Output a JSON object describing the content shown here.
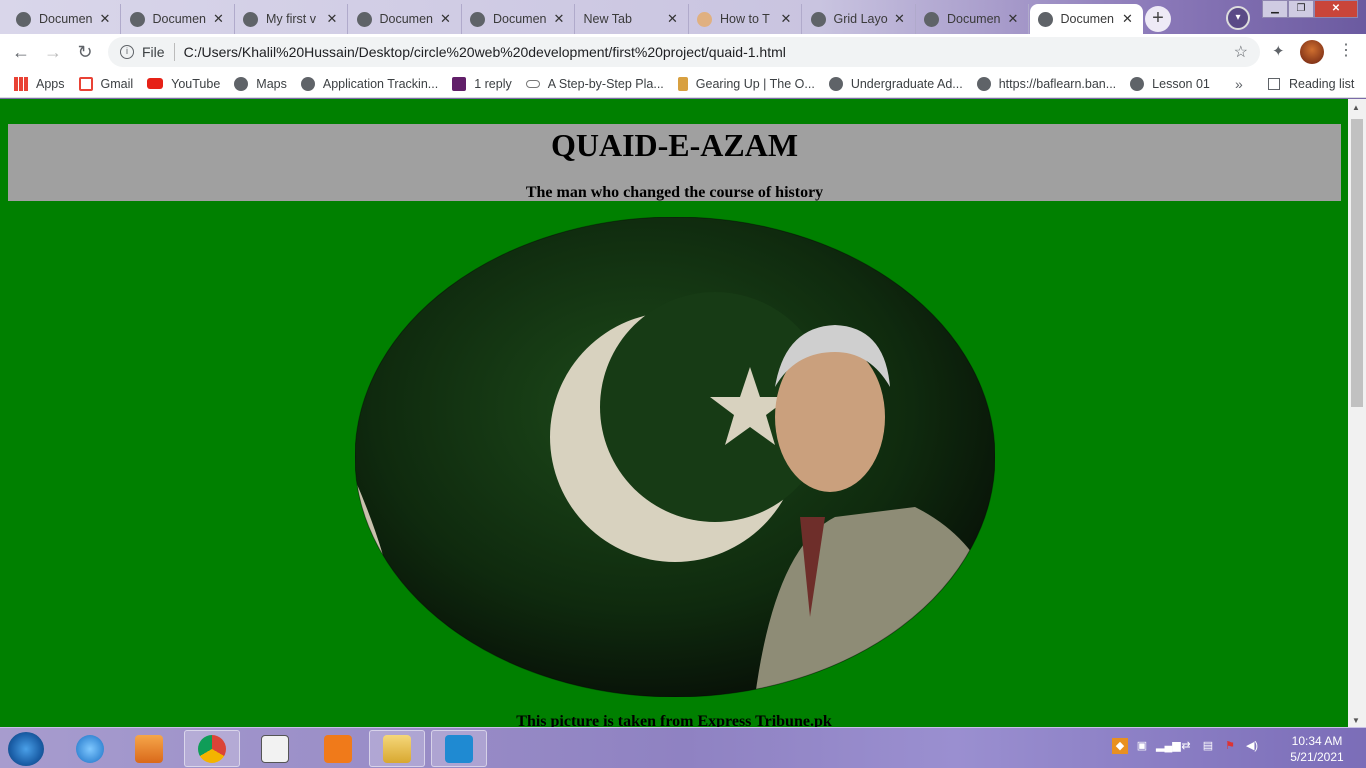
{
  "browser": {
    "tabs": [
      {
        "label": "Documen",
        "icon": "globe-icon"
      },
      {
        "label": "Documen",
        "icon": "globe-icon"
      },
      {
        "label": "My first v",
        "icon": "globe-icon"
      },
      {
        "label": "Documen",
        "icon": "globe-icon"
      },
      {
        "label": "Documen",
        "icon": "globe-icon"
      },
      {
        "label": "New Tab",
        "icon": "none"
      },
      {
        "label": "How to T",
        "icon": "face-icon"
      },
      {
        "label": "Grid Layo",
        "icon": "globe-icon"
      },
      {
        "label": "Documen",
        "icon": "globe-icon"
      },
      {
        "label": "Documen",
        "icon": "globe-icon"
      }
    ],
    "active_tab_index": 9,
    "address": {
      "scheme_label": "File",
      "url": "C:/Users/Khalil%20Hussain/Desktop/circle%20web%20development/first%20project/quaid-1.html"
    },
    "bookmarks": [
      {
        "label": "Apps",
        "icon": "apps-grid-icon"
      },
      {
        "label": "Gmail",
        "icon": "gmail-icon"
      },
      {
        "label": "YouTube",
        "icon": "youtube-icon"
      },
      {
        "label": "Maps",
        "icon": "globe-icon"
      },
      {
        "label": "Application Trackin...",
        "icon": "globe-icon"
      },
      {
        "label": "1 reply",
        "icon": "slack-icon"
      },
      {
        "label": "A Step-by-Step Pla...",
        "icon": "link-icon"
      },
      {
        "label": "Gearing Up | The O...",
        "icon": "mug-icon"
      },
      {
        "label": "Undergraduate Ad...",
        "icon": "globe-icon"
      },
      {
        "label": "https://baflearn.ban...",
        "icon": "globe-icon"
      },
      {
        "label": "Lesson 01",
        "icon": "globe-icon"
      }
    ],
    "more_bookmarks": "»",
    "reading_list": "Reading list"
  },
  "page": {
    "title": "QUAID-E-AZAM",
    "subtitle": "The man who changed the course of history",
    "image_alt": "Quaid-e-Azam portrait with Pakistan flag",
    "caption": "This picture is taken from Express Tribune.pk",
    "colors": {
      "background": "#008000",
      "header": "#a0a0a0"
    }
  },
  "taskbar": {
    "apps": [
      "internet-explorer-icon",
      "media-player-icon",
      "chrome-icon",
      "notepad-icon",
      "foxit-pdf-icon",
      "file-explorer-icon",
      "vscode-icon"
    ],
    "time": "10:34 AM",
    "date": "5/21/2021"
  }
}
